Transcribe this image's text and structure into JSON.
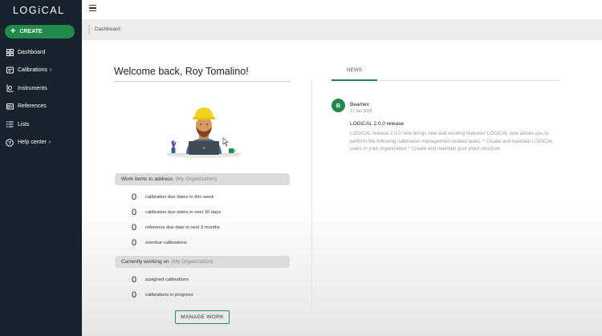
{
  "app": {
    "logo_text": "LOGiCAL"
  },
  "sidebar": {
    "create_label": "CREATE",
    "items": [
      {
        "label": "Dashboard",
        "icon": "dashboard-icon",
        "has_chevron": false
      },
      {
        "label": "Calibrations",
        "icon": "calibrations-icon",
        "has_chevron": true
      },
      {
        "label": "Instruments",
        "icon": "instruments-icon",
        "has_chevron": false
      },
      {
        "label": "References",
        "icon": "references-icon",
        "has_chevron": false
      },
      {
        "label": "Lists",
        "icon": "lists-icon",
        "has_chevron": false
      },
      {
        "label": "Help center",
        "icon": "help-icon",
        "has_chevron": true
      }
    ]
  },
  "breadcrumb": {
    "current": "Dashboard"
  },
  "main": {
    "welcome": "Welcome back, Roy Tomalino!",
    "work_items": {
      "title": "Work items to address",
      "scope": "(My Organization)",
      "rows": [
        {
          "count": "0",
          "label": "calibration due dates in this week"
        },
        {
          "count": "0",
          "label": "calibration due dates in next 30 days"
        },
        {
          "count": "0",
          "label": "reference due date in next 3 months"
        },
        {
          "count": "0",
          "label": "overdue calibrations"
        }
      ]
    },
    "currently_working": {
      "title": "Currently working on",
      "scope": "(My Organization)",
      "rows": [
        {
          "count": "0",
          "label": "assigned calibrations"
        },
        {
          "count": "0",
          "label": "calibrations in progress"
        }
      ]
    },
    "manage_button": "MANAGE WORK"
  },
  "news": {
    "tab_label": "NEWS",
    "items": [
      {
        "avatar_letter": "B",
        "author": "Beamex",
        "date": "17 Jun 2020",
        "title": "LOGiCAL 2.0.0 release",
        "body": "LOGiCAL release 2.0.0 now brings new and exciting features! LOGiCAL now allows you to perform the following calibration management related tasks: * Create and maintain LOGiCAL users in your organization * Create and maintain your plant structure"
      }
    ]
  },
  "colors": {
    "sidebar_bg": "#17222d",
    "brand_green": "#1f8a4c"
  }
}
